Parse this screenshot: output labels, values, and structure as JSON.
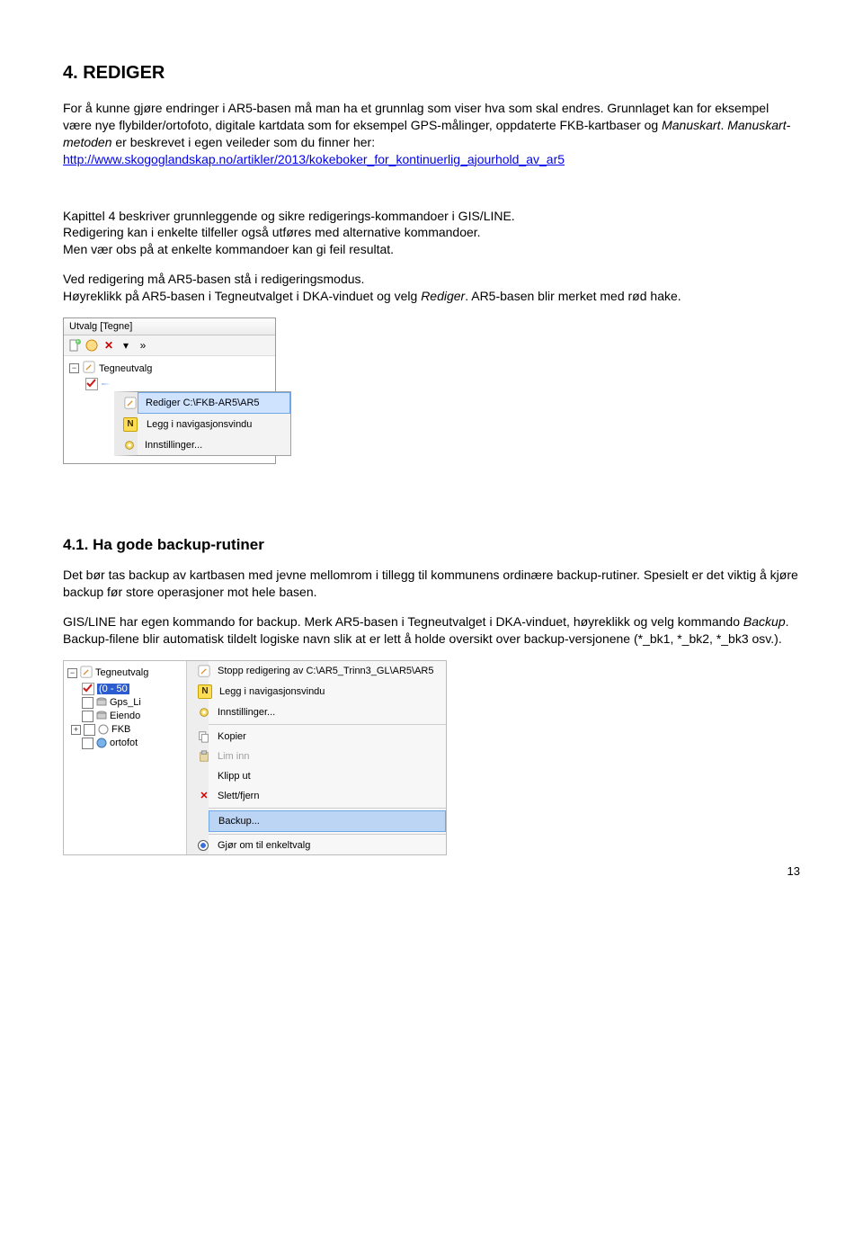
{
  "heading1": "4.  REDIGER",
  "intro_p1": "For å kunne gjøre endringer i AR5-basen må man ha et grunnlag som viser hva som skal endres. Grunnlaget kan for eksempel være nye flybilder/ortofoto, digitale kartdata som for eksempel GPS-målinger, oppdaterte FKB-kartbaser og ",
  "intro_manuskart1": "Manuskart",
  "intro_p1b": ". ",
  "intro_manuskart2": "Manuskart-metoden",
  "intro_p2": " er beskrevet i egen veileder som du finner her:",
  "manuskart_link": "http://www.skogoglandskap.no/artikler/2013/kokeboker_for_kontinuerlig_ajourhold_av_ar5",
  "para_kap4": "Kapittel 4 beskriver grunnleggende og sikre redigerings-kommandoer i GIS/LINE.\nRedigering kan i enkelte tilfeller også utføres med alternative kommandoer.\nMen vær obs på at enkelte kommandoer kan gi feil resultat.",
  "para_redmode1": "Ved redigering må AR5-basen stå i redigeringsmodus.",
  "para_redmode2a": "Høyreklikk på AR5-basen i Tegneutvalget i DKA-vinduet og velg ",
  "para_rediger_italic": "Rediger",
  "para_redmode2b": ". AR5-basen blir merket med rød hake.",
  "ss1": {
    "panel_title": "Utvalg [Tegne]",
    "tree_root": "Tegneutvalg",
    "menu_item1": "Rediger C:\\FKB-AR5\\AR5",
    "menu_item2": "Legg i navigasjonsvindu",
    "menu_item3": "Innstillinger..."
  },
  "heading2": "4.1.    Ha gode backup-rutiner",
  "backup_p1": "Det bør tas backup av kartbasen med jevne mellomrom i tillegg til kommunens ordinære backup-rutiner. Spesielt er det viktig å kjøre backup før store operasjoner mot hele basen.",
  "backup_p2a": "GIS/LINE har egen kommando for backup. Merk AR5-basen i Tegneutvalget i DKA-vinduet, høyreklikk og velg kommando ",
  "backup_italic": "Backup",
  "backup_p2b": ".",
  "backup_p3": "Backup-filene blir automatisk tildelt logiske navn slik at er lett å holde oversikt over backup-versjonene (*_bk1, *_bk2, *_bk3 osv.).",
  "ss2": {
    "left": {
      "root": "Tegneutvalg",
      "sel": "(0 - 50",
      "item1": "Gps_Li",
      "item2": "Eiendo",
      "item3": "FKB",
      "item4": "ortofot"
    },
    "right": {
      "stop": "Stopp redigering av C:\\AR5_Trinn3_GL\\AR5\\AR5",
      "nav": "Legg i navigasjonsvindu",
      "settings": "Innstillinger...",
      "copy": "Kopier",
      "paste": "Lim inn",
      "cut": "Klipp ut",
      "del": "Slett/fjern",
      "backup": "Backup...",
      "single": "Gjør om til enkeltvalg"
    }
  },
  "page_number": "13"
}
